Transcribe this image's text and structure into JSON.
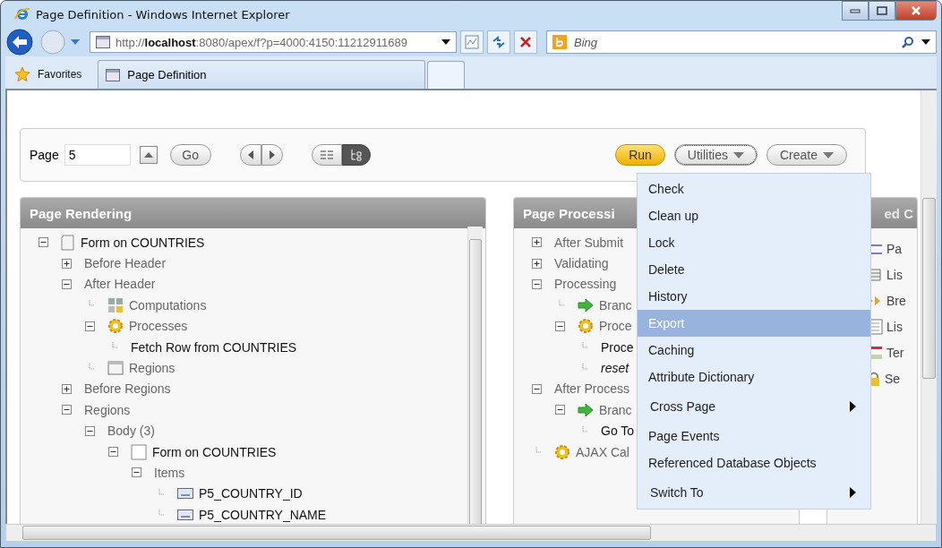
{
  "window": {
    "title": "Page Definition - Windows Internet Explorer"
  },
  "address_bar": {
    "url": "http://**localhost**:8080/apex/f?p=4000:4150:11212911689"
  },
  "search": {
    "placeholder": "Bing"
  },
  "favorites": {
    "label": "Favorites"
  },
  "tabs": [
    {
      "label": "Page Definition",
      "selected": true
    }
  ],
  "toolbar": {
    "page_label": "Page",
    "page_value": "5",
    "go": "Go",
    "view_toggles": [
      {
        "kind": "list",
        "selected": false
      },
      {
        "kind": "tree",
        "selected": true
      }
    ],
    "run": "Run",
    "utilities": "Utilities",
    "create": "Create"
  },
  "panels": [
    {
      "title": "Page Rendering",
      "tree": [
        {
          "label": "Form on COUNTRIES",
          "kind": "page",
          "expanded": true,
          "children": [
            {
              "label": "Before Header",
              "kind": "category",
              "expanded": false
            },
            {
              "label": "After Header",
              "kind": "category",
              "expanded": true,
              "children": [
                {
                  "label": "Computations",
                  "kind": "computations"
                },
                {
                  "label": "Processes",
                  "kind": "processes",
                  "expanded": true,
                  "children": [
                    {
                      "label": "Fetch Row from COUNTRIES",
                      "kind": "process"
                    }
                  ]
                },
                {
                  "label": "Regions",
                  "kind": "regions"
                }
              ]
            },
            {
              "label": "Before Regions",
              "kind": "category",
              "expanded": false
            },
            {
              "label": "Regions",
              "kind": "category",
              "expanded": true,
              "children": [
                {
                  "label": "Body (3)",
                  "kind": "group",
                  "expanded": true,
                  "children": [
                    {
                      "label": "Form on COUNTRIES",
                      "kind": "region",
                      "expanded": true,
                      "children": [
                        {
                          "label": "Items",
                          "kind": "category",
                          "expanded": true,
                          "children": [
                            {
                              "label": "P5_COUNTRY_ID",
                              "kind": "item"
                            },
                            {
                              "label": "P5_COUNTRY_NAME",
                              "kind": "item"
                            }
                          ]
                        }
                      ]
                    }
                  ]
                }
              ]
            }
          ]
        }
      ]
    },
    {
      "title": "Page Processi",
      "tree": [
        {
          "label": "After Submit",
          "kind": "category",
          "expanded": false
        },
        {
          "label": "Validating",
          "kind": "category",
          "expanded": false
        },
        {
          "label": "Processing",
          "kind": "category",
          "expanded": true,
          "children": [
            {
              "label": "Branc",
              "kind": "branch"
            },
            {
              "label": "Proce",
              "kind": "processes",
              "expanded": true,
              "children": [
                {
                  "label": "Proce",
                  "kind": "process"
                },
                {
                  "label": "reset",
                  "kind": "process",
                  "italic": true
                }
              ]
            }
          ]
        },
        {
          "label": "After Process",
          "kind": "category",
          "expanded": true,
          "children": [
            {
              "label": "Branc",
              "kind": "branch",
              "expanded": true,
              "children": [
                {
                  "label": "Go To",
                  "kind": "process"
                }
              ]
            }
          ]
        },
        {
          "label": "AJAX Cal",
          "kind": "ajax"
        }
      ]
    },
    {
      "title": "ed C",
      "shared": [
        {
          "kind": "page-template",
          "label": "Pa"
        },
        {
          "kind": "list",
          "label": "Lis"
        },
        {
          "kind": "breadcrumb",
          "label": "Bre"
        },
        {
          "kind": "list-template",
          "label": "Lis"
        },
        {
          "kind": "template",
          "label": "Ter"
        },
        {
          "kind": "security",
          "label": "Se"
        }
      ]
    }
  ],
  "menu": [
    {
      "label": "Check",
      "selected": false,
      "submenu": false
    },
    {
      "label": "Clean up",
      "selected": false,
      "submenu": false
    },
    {
      "label": "Lock",
      "selected": false,
      "submenu": false
    },
    {
      "label": "Delete",
      "selected": false,
      "submenu": false
    },
    {
      "label": "History",
      "selected": false,
      "submenu": false
    },
    {
      "label": "Export",
      "selected": true,
      "submenu": false
    },
    {
      "label": "Caching",
      "selected": false,
      "submenu": false
    },
    {
      "label": "Attribute Dictionary",
      "selected": false,
      "submenu": false
    },
    {
      "label": "Cross Page",
      "selected": false,
      "submenu": true
    },
    {
      "label": "Page Events",
      "selected": false,
      "submenu": false
    },
    {
      "label": "Referenced Database Objects",
      "selected": false,
      "submenu": false
    },
    {
      "label": "Switch To",
      "selected": false,
      "submenu": true
    }
  ]
}
